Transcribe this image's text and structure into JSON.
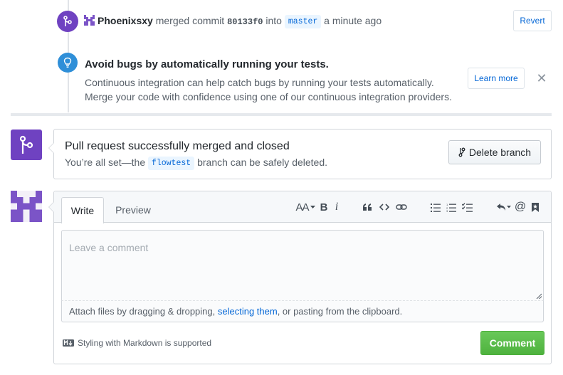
{
  "merge_event": {
    "author": "Phoenixsxy",
    "action": "merged commit",
    "commit_sha": "80133f0",
    "into_text": "into",
    "branch": "master",
    "time": "a minute ago",
    "revert_label": "Revert"
  },
  "ci_tip": {
    "title": "Avoid bugs by automatically running your tests.",
    "line1": "Continuous integration can help catch bugs by running your tests automatically.",
    "line2": "Merge your code with confidence using one of our continuous integration providers.",
    "learn_more_label": "Learn more",
    "dismiss_symbol": "✕"
  },
  "merged_box": {
    "title": "Pull request successfully merged and closed",
    "sub_prefix": "You’re all set—the",
    "branch": "flowtest",
    "sub_suffix": "branch can be safely deleted.",
    "delete_label": "Delete branch"
  },
  "comment": {
    "tabs": [
      "Write",
      "Preview"
    ],
    "toolbar": {
      "header": "AA",
      "bold": "B",
      "italic": "i"
    },
    "toolbar_icons": [
      "header-icon",
      "bold-icon",
      "italic-icon",
      "quote-icon",
      "code-icon",
      "link-icon",
      "unordered-list-icon",
      "ordered-list-icon",
      "task-list-icon",
      "reply-icon",
      "mention-icon",
      "saved-reply-icon"
    ],
    "placeholder": "Leave a comment",
    "attach_prefix": "Attach files by dragging & dropping, ",
    "attach_link": "selecting them",
    "attach_suffix": ", or pasting from the clipboard.",
    "markdown_note": "Styling with Markdown is supported",
    "submit_label": "Comment"
  },
  "colors": {
    "merged_purple": "#6f42c1",
    "ci_blue": "#2f8fd8",
    "link_blue": "#0366d6",
    "comment_green": "#4eb23e"
  }
}
